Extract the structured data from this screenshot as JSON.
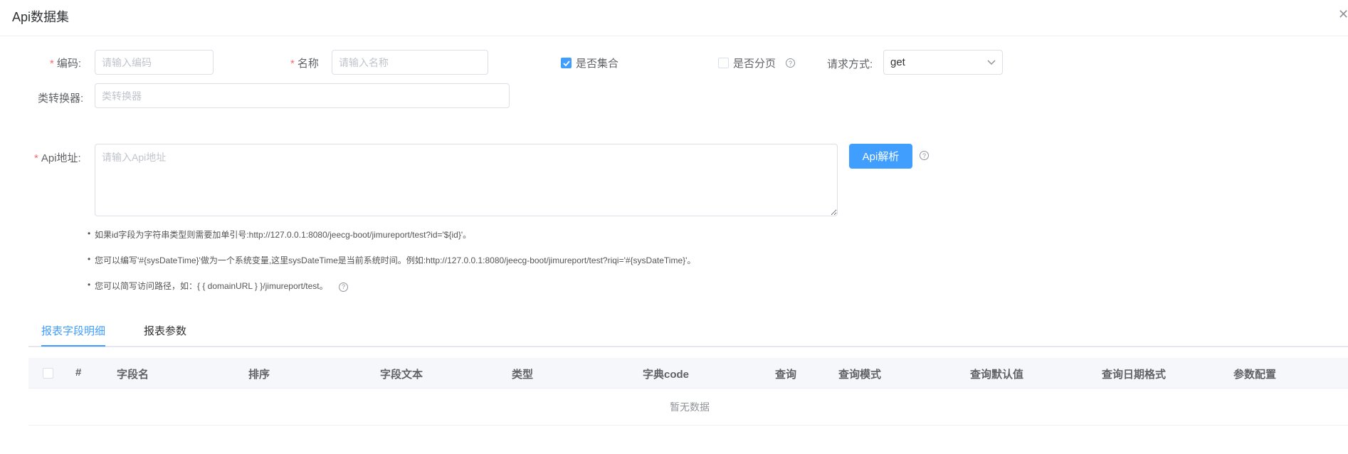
{
  "dialog": {
    "title": "Api数据集"
  },
  "form": {
    "code": {
      "label": "编码:",
      "placeholder": "请输入编码"
    },
    "name": {
      "label": "名称",
      "placeholder": "请输入名称"
    },
    "is_collection": {
      "label": "是否集合",
      "checked": true
    },
    "is_paged": {
      "label": "是否分页",
      "checked": false
    },
    "method": {
      "label": "请求方式:",
      "value": "get"
    },
    "converter": {
      "label": "类转换器:",
      "placeholder": "类转换器"
    },
    "api_url": {
      "label": "Api地址:",
      "placeholder": "请输入Api地址"
    },
    "parse_button": "Api解析"
  },
  "tips": [
    "如果id字段为字符串类型则需要加单引号:http://127.0.0.1:8080/jeecg-boot/jimureport/test?id='${id}'。",
    "您可以编写'#{sysDateTime}'做为一个系统变量,这里sysDateTime是当前系统时间。例如:http://127.0.0.1:8080/jeecg-boot/jimureport/test?riqi='#{sysDateTime}'。",
    "您可以简写访问路径，如：{ { domainURL } }/jimureport/test。"
  ],
  "tabs": [
    {
      "label": "报表字段明细",
      "active": true
    },
    {
      "label": "报表参数",
      "active": false
    }
  ],
  "table": {
    "columns": [
      "#",
      "字段名",
      "排序",
      "字段文本",
      "类型",
      "字典code",
      "查询",
      "查询模式",
      "查询默认值",
      "查询日期格式",
      "参数配置"
    ],
    "empty_text": "暂无数据"
  },
  "colors": {
    "primary": "#409eff",
    "required": "#f56c6c"
  }
}
